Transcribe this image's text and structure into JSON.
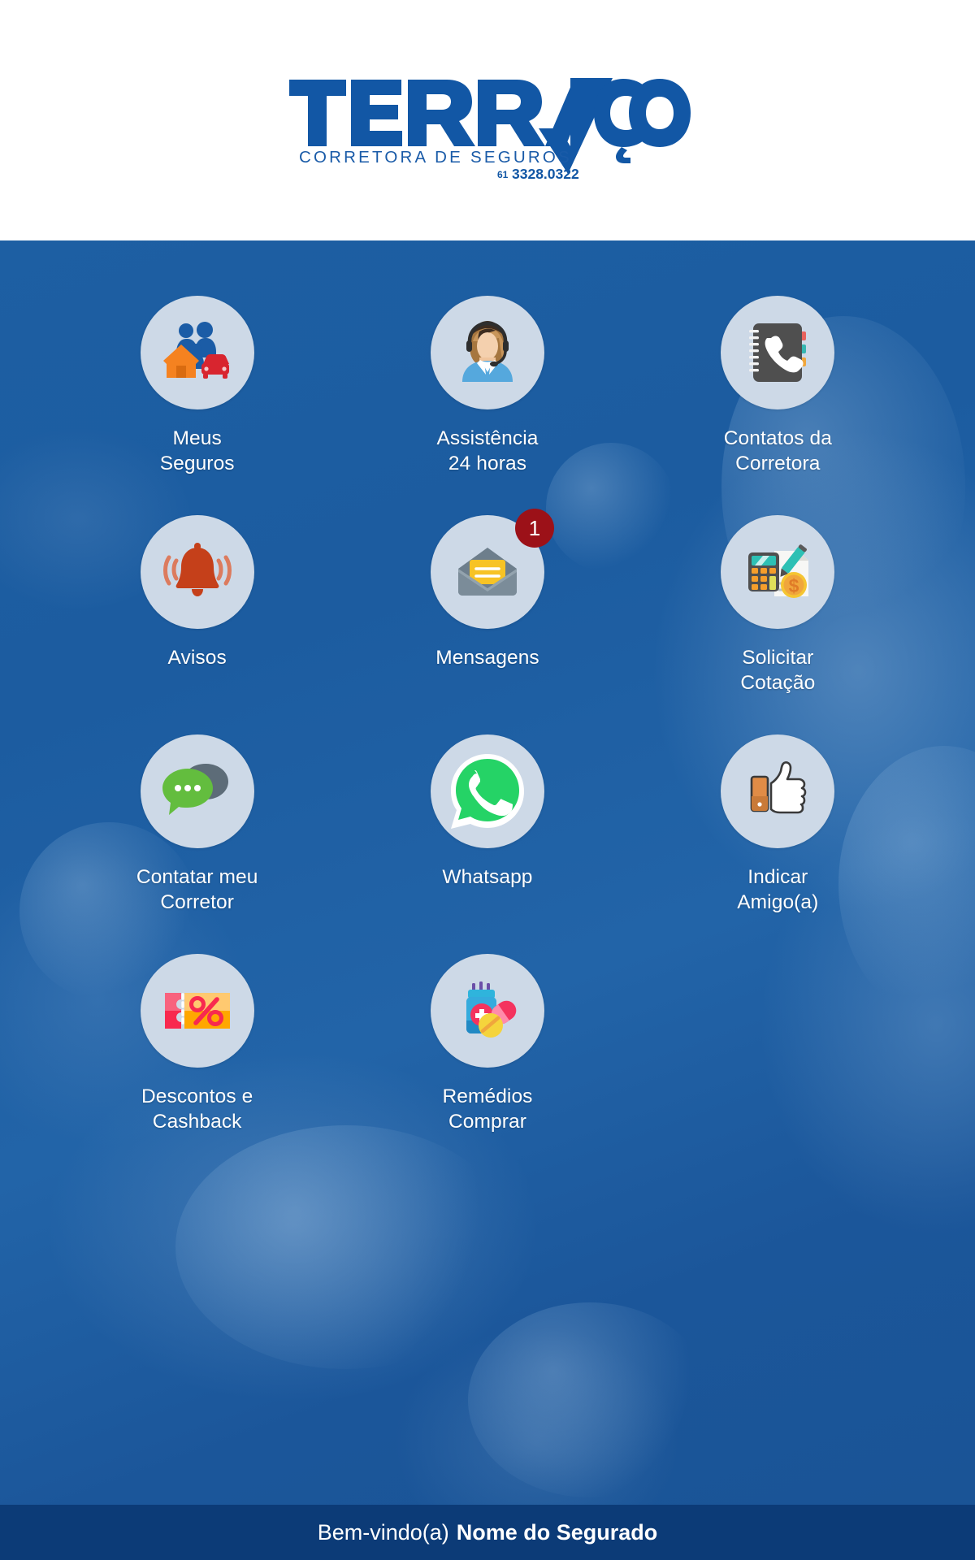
{
  "header": {
    "logo_name": "TERRAÇO",
    "logo_tagline": "CORRETORA DE SEGUROS",
    "logo_phone_prefix": "61",
    "logo_phone": "3328.0322",
    "logo_color": "#1257a5",
    "logo_dark": "#0d4b92"
  },
  "theme": {
    "background_blue": "#1d5fa3",
    "circle_bg": "#cdd9e7",
    "label_color": "#ffffff",
    "badge_bg": "#9c1118",
    "footer_bg": "#0c3b77"
  },
  "menu": {
    "items": [
      {
        "id": "meus-seguros",
        "label": "Meus\nSeguros",
        "icon": "family-home-car-icon",
        "badge": null
      },
      {
        "id": "assistencia-24h",
        "label": "Assistência\n24 horas",
        "icon": "headset-agent-icon",
        "badge": null
      },
      {
        "id": "contatos",
        "label": "Contatos da\nCorretora",
        "icon": "contact-book-icon",
        "badge": null
      },
      {
        "id": "avisos",
        "label": "Avisos",
        "icon": "bell-icon",
        "badge": null
      },
      {
        "id": "mensagens",
        "label": "Mensagens",
        "icon": "envelope-open-icon",
        "badge": "1"
      },
      {
        "id": "solicitar-cotacao",
        "label": "Solicitar\nCotação",
        "icon": "calculator-quote-icon",
        "badge": null
      },
      {
        "id": "contatar-corretor",
        "label": "Contatar meu\nCorretor",
        "icon": "chat-bubbles-icon",
        "badge": null
      },
      {
        "id": "whatsapp",
        "label": "Whatsapp",
        "icon": "whatsapp-icon",
        "badge": null
      },
      {
        "id": "indicar-amigo",
        "label": "Indicar\nAmigo(a)",
        "icon": "thumbs-up-icon",
        "badge": null
      },
      {
        "id": "descontos",
        "label": "Descontos e\nCashback",
        "icon": "discount-coupon-icon",
        "badge": null
      },
      {
        "id": "remedios",
        "label": "Remédios\nComprar",
        "icon": "medicine-pills-icon",
        "badge": null
      }
    ]
  },
  "footer": {
    "greeting": "Bem-vindo(a)",
    "user_name": "Nome do Segurado"
  }
}
